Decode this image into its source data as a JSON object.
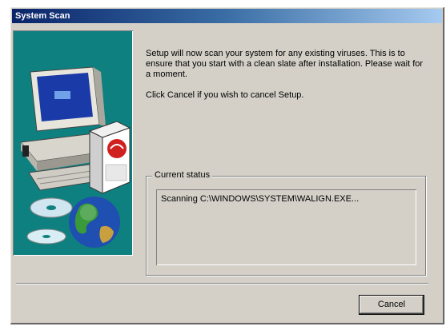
{
  "window": {
    "title": "System Scan"
  },
  "message": {
    "paragraph1": "Setup will now scan your system for any existing viruses. This is to ensure that you start with a clean slate after installation. Please wait for a moment.",
    "paragraph2": "Click Cancel if you wish to cancel Setup."
  },
  "status": {
    "group_label": "Current status",
    "text": "Scanning C:\\WINDOWS\\SYSTEM\\WALIGN.EXE..."
  },
  "buttons": {
    "cancel_label": "Cancel"
  },
  "colors": {
    "art_background": "#0f8080",
    "dialog_face": "#d4d0c8",
    "title_start": "#0a246a"
  },
  "icons": [
    "computer-icon",
    "product-box-icon",
    "cd-discs-icon",
    "globe-icon"
  ]
}
